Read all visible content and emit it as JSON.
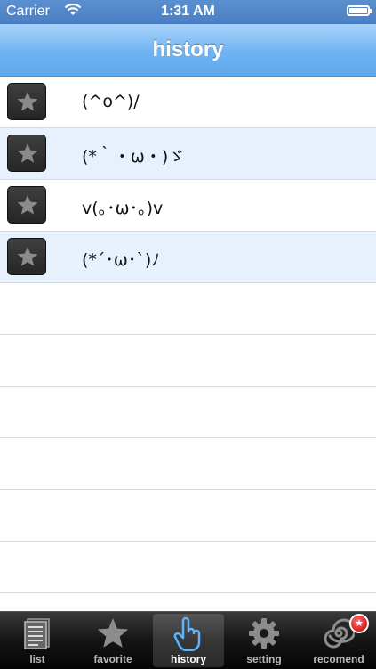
{
  "status_bar": {
    "carrier": "Carrier",
    "time": "1:31 AM"
  },
  "nav": {
    "title": "history"
  },
  "history_items": [
    {
      "face": "(^o^)/"
    },
    {
      "face": "(*｀・ω・)ゞ"
    },
    {
      "face": "v(｡･ω･｡)v"
    },
    {
      "face": "(*´･ω･`)ﾉ"
    }
  ],
  "tabs": [
    {
      "label": "list",
      "icon": "list-icon",
      "active": false
    },
    {
      "label": "favorite",
      "icon": "star-icon",
      "active": false
    },
    {
      "label": "history",
      "icon": "hand-pointer-icon",
      "active": true
    },
    {
      "label": "setting",
      "icon": "gear-icon",
      "active": false
    },
    {
      "label": "recomend",
      "icon": "spiral-icon",
      "active": false,
      "badge": "★"
    }
  ],
  "colors": {
    "nav_gradient_top": "#a8d4fb",
    "nav_gradient_bottom": "#5ea8ee",
    "row_alt_background": "#e6f1fd",
    "badge_red": "#c40000"
  }
}
